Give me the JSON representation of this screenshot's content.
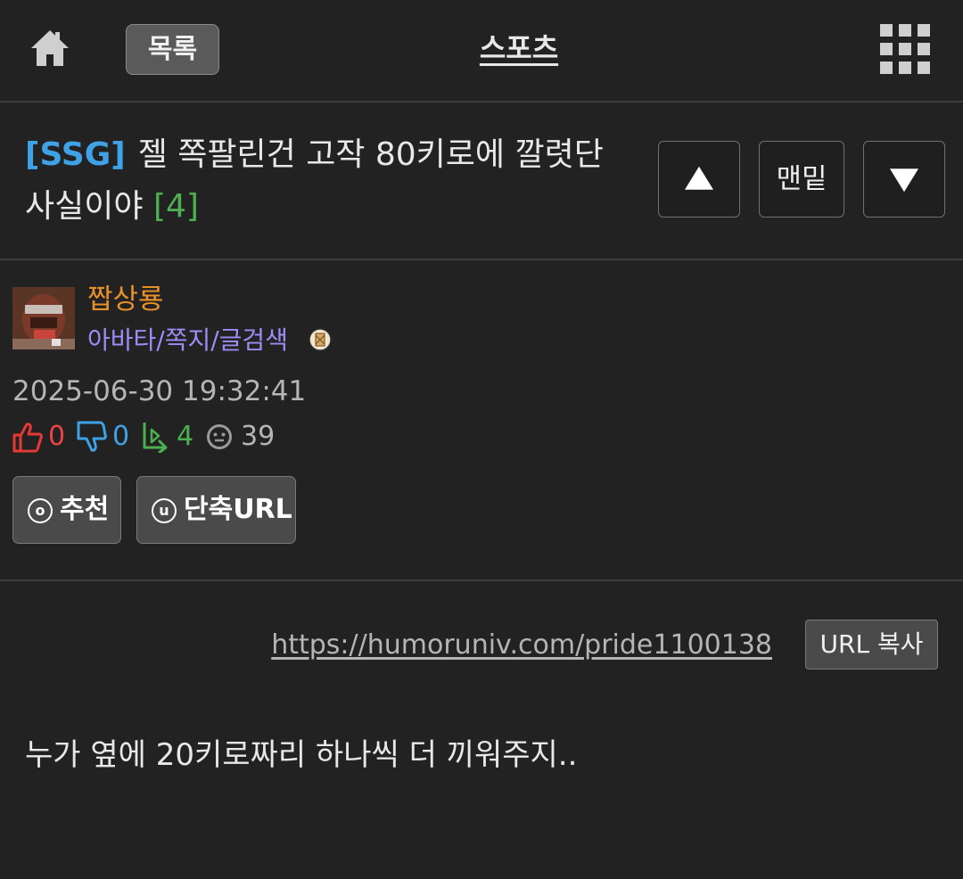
{
  "topbar": {
    "list_label": "목록",
    "board_title": "스포츠"
  },
  "post": {
    "tag": "[SSG]",
    "title": "젤 쪽팔린건 고작 80키로에 깔렷단 사실이야",
    "comment_count": "[4]"
  },
  "nav": {
    "bottom_label": "맨밑"
  },
  "author": {
    "name": "짭상룡",
    "links": "아바타/쪽지/글검색"
  },
  "meta": {
    "date": "2025-06-30 19:32:41",
    "likes": "0",
    "dislikes": "0",
    "replies": "4",
    "views": "39"
  },
  "actions": {
    "recommend_label": "추천",
    "recommend_glyph": "o",
    "shorturl_label": "단축URL",
    "shorturl_glyph": "u"
  },
  "share": {
    "url": "https://humoruniv.com/pride1100138",
    "copy_label": "URL 복사"
  },
  "content": {
    "body": "누가 옆에 20키로짜리 하나씩 더 끼워주지.."
  },
  "colors": {
    "background": "#222222",
    "tag": "#3fa2e6",
    "comment_count": "#4caf50",
    "author": "#e8902a",
    "links": "#9c8cf5",
    "like": "#ee4444",
    "dislike": "#3fa2e6",
    "reply": "#4caf50"
  }
}
